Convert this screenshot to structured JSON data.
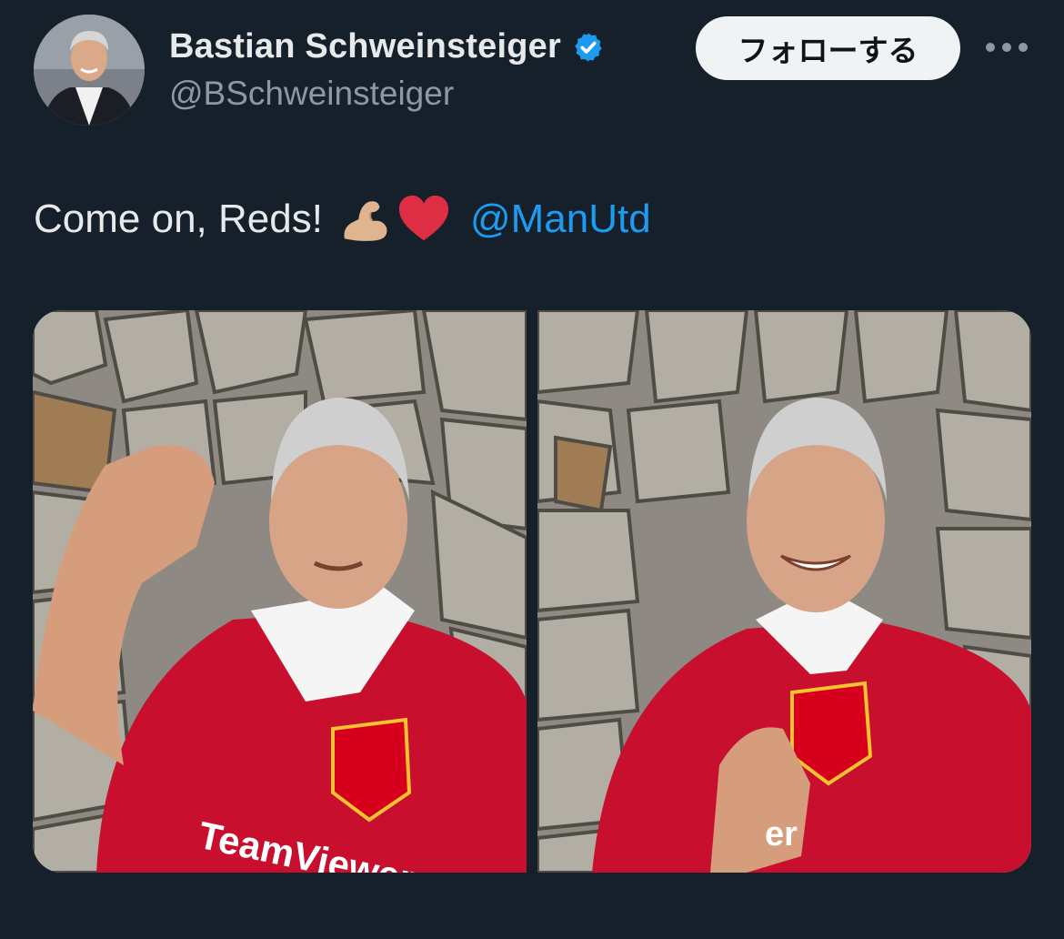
{
  "user": {
    "display_name": "Bastian Schweinsteiger",
    "handle": "@BSchweinsteiger",
    "verified": true,
    "verified_icon": "verified-badge-icon",
    "avatar_icon": "profile-avatar"
  },
  "actions": {
    "follow_label": "フォローする",
    "more_icon": "more-options-icon"
  },
  "tweet": {
    "text": "Come on, Reds!",
    "emojis": [
      "flexed-biceps-emoji",
      "red-heart-emoji"
    ],
    "mention": "@ManUtd"
  },
  "media": {
    "photos": [
      {
        "icon": "photo-1"
      },
      {
        "icon": "photo-2"
      }
    ],
    "shirt_text_1": "TeamViewer",
    "shirt_text_2": "er"
  },
  "colors": {
    "background": "#15202b",
    "text": "#e7e9ea",
    "secondary": "#8b98a5",
    "accent": "#1d9bf0",
    "follow_bg": "#eff3f4",
    "jersey_red": "#c8102e"
  }
}
